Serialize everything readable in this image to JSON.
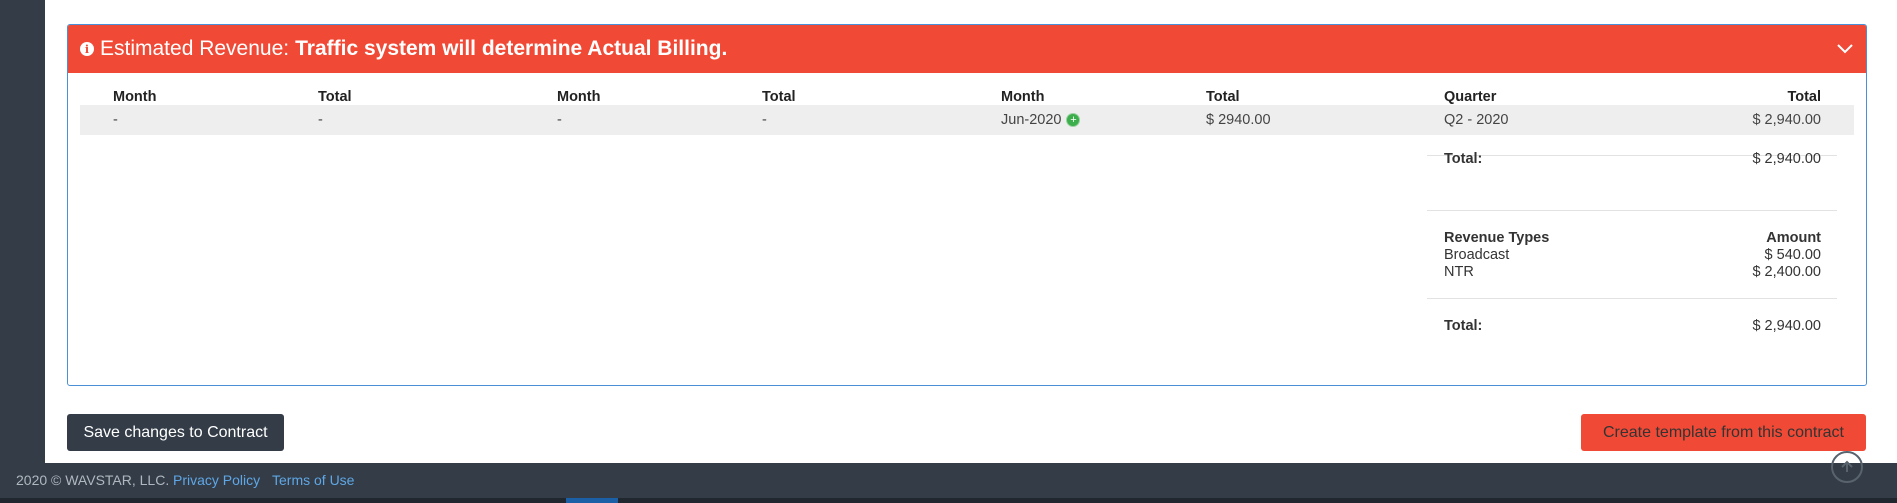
{
  "panel": {
    "title_prefix": "Estimated Revenue:",
    "title_strong": "Traffic system will determine Actual Billing.",
    "icons": {
      "info": "info-icon",
      "collapse": "chevron-down-icon"
    }
  },
  "table": {
    "headers": [
      "Month",
      "Total",
      "Month",
      "Total",
      "Month",
      "Total",
      "Quarter",
      "Total"
    ],
    "row": [
      "-",
      "-",
      "-",
      "-",
      "Jun-2020",
      "$ 2940.00",
      "Q2 - 2020",
      "$ 2,940.00"
    ],
    "add_icon": "plus-circle-icon"
  },
  "summary": {
    "total1_label": "Total:",
    "total1_value": "$ 2,940.00",
    "types_header": "Revenue Types",
    "amount_header": "Amount",
    "types": [
      {
        "name": "Broadcast",
        "amount": "$ 540.00"
      },
      {
        "name": "NTR",
        "amount": "$ 2,400.00"
      }
    ],
    "total2_label": "Total:",
    "total2_value": "$ 2,940.00"
  },
  "actions": {
    "save_label": "Save changes to Contract",
    "template_label": "Create template from this contract"
  },
  "footer": {
    "copyright": "2020 © WAVSTAR, LLC.",
    "privacy": "Privacy Policy",
    "terms": "Terms of Use",
    "to_top_icon": "arrow-up-circle-icon"
  },
  "colors": {
    "accent": "#f04a36",
    "dark": "#333c47",
    "link": "#5fa7e6",
    "border": "#4a90d9"
  }
}
